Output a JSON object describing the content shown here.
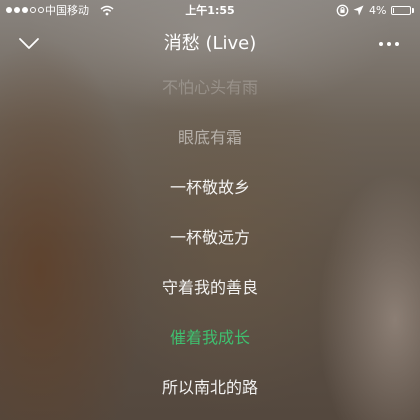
{
  "status_bar": {
    "carrier": "中国移动",
    "time": "上午1:55",
    "battery_percent": "4%",
    "battery_level": 0.04
  },
  "header": {
    "back_icon": "chevron-down-icon",
    "title": "消愁 (Live)",
    "more_icon": "ellipsis-icon"
  },
  "lyrics": [
    {
      "text": "不怕心头有雨",
      "state": "faded"
    },
    {
      "text": "眼底有霜",
      "state": "dim"
    },
    {
      "text": "一杯敬故乡",
      "state": "normal"
    },
    {
      "text": "一杯敬远方",
      "state": "normal"
    },
    {
      "text": "守着我的善良",
      "state": "normal"
    },
    {
      "text": "催着我成长",
      "state": "current"
    },
    {
      "text": "所以南北的路",
      "state": "normal"
    }
  ],
  "colors": {
    "current_lyric": "#3fbf6f",
    "text": "#ffffff"
  }
}
